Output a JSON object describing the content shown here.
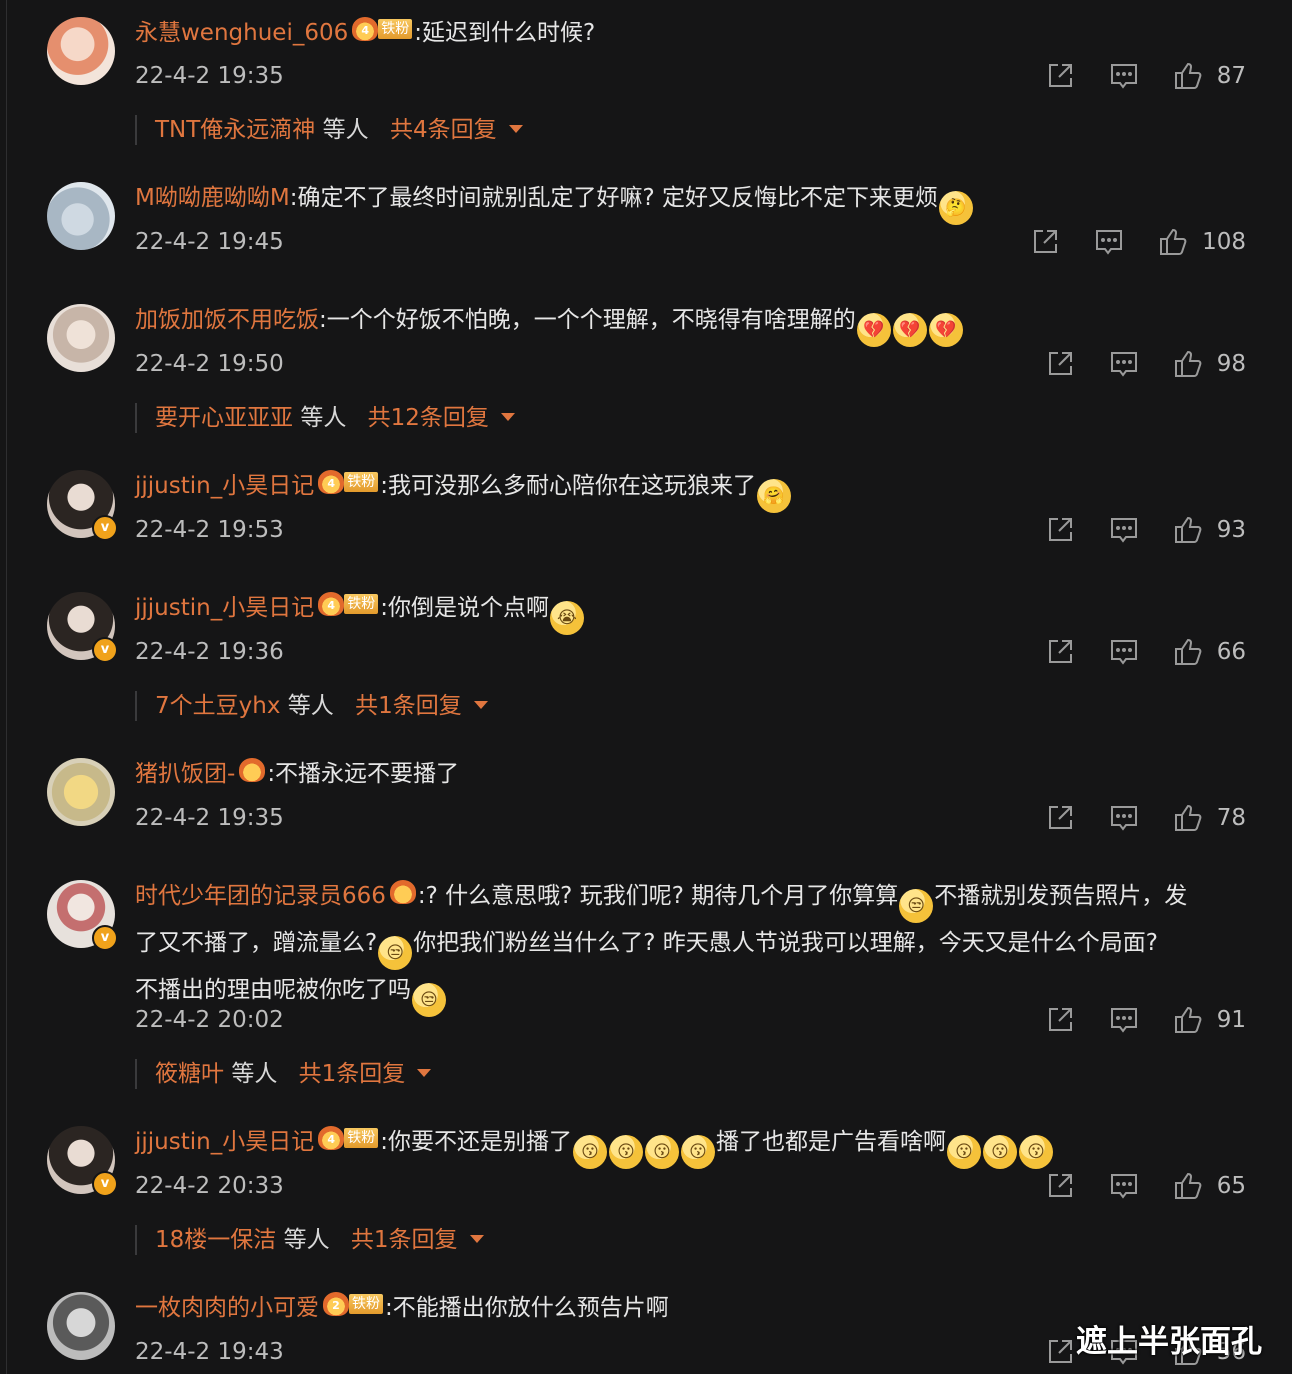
{
  "fan_badge_label": "铁粉",
  "comments": [
    {
      "username": "永慧wenghuei_606",
      "badge_level": "4",
      "content": ":延迟到什么时候?",
      "time": "22-4-2 19:35",
      "likes": "87",
      "replies": {
        "name": "TNT俺永远滴神",
        "mid": "等人",
        "count": "共4条回复"
      }
    },
    {
      "username": "M呦呦鹿呦呦M",
      "content": ":确定不了最终时间就别乱定了好嘛? 定好又反悔比不定下来更烦",
      "emoji_after": [
        "🤔"
      ],
      "time": "22-4-2 19:45",
      "likes": "108"
    },
    {
      "username": "加饭加饭不用吃饭",
      "content": ":一个个好饭不怕晚，一个个理解，不晓得有啥理解的",
      "emoji_after": [
        "💔",
        "💔",
        "💔"
      ],
      "time": "22-4-2 19:50",
      "likes": "98",
      "replies": {
        "name": "要开心亚亚亚",
        "mid": "等人",
        "count": "共12条回复"
      }
    },
    {
      "username": "jjjustin_小昊日记",
      "badge_level": "4",
      "content": ":我可没那么多耐心陪你在这玩狼来了",
      "emoji_after": [
        "🤗"
      ],
      "time": "22-4-2 19:53",
      "likes": "93"
    },
    {
      "username": "jjjustin_小昊日记",
      "badge_level": "4",
      "content": ":你倒是说个点啊",
      "emoji_after": [
        "😭"
      ],
      "time": "22-4-2 19:36",
      "likes": "66",
      "replies": {
        "name": "7个土豆yhx",
        "mid": "等人",
        "count": "共1条回复"
      }
    },
    {
      "username": "猪扒饭团-",
      "content": ":不播永远不要播了",
      "time": "22-4-2 19:35",
      "likes": "78"
    },
    {
      "username": "时代少年团的记录员666",
      "lines": [
        ":? 什么意思哦? 玩我们呢? 期待几个月了你算算",
        "不播就别发预告照片，发",
        "了又不播了，蹭流量么?",
        "你把我们粉丝当什么了? 昨天愚人节说我可以理解，今天又是什么个局面?",
        "不播出的理由呢被你吃了吗"
      ],
      "time": "22-4-2 20:02",
      "likes": "91",
      "replies": {
        "name": "筱糖叶",
        "mid": "等人",
        "count": "共1条回复"
      }
    },
    {
      "username": "jjjustin_小昊日记",
      "badge_level": "4",
      "content": ":你要不还是别播了",
      "content_mid": "播了也都是广告看啥啊",
      "time": "22-4-2 20:33",
      "likes": "65",
      "replies": {
        "name": "18楼一保洁",
        "mid": "等人",
        "count": "共1条回复"
      }
    },
    {
      "username": "一枚肉肉的小可爱",
      "badge_level": "2",
      "content": ":不能播出你放什么预告片啊",
      "time": "22-4-2 19:43",
      "likes": "56"
    }
  ],
  "watermark": "遮上半张面孔"
}
